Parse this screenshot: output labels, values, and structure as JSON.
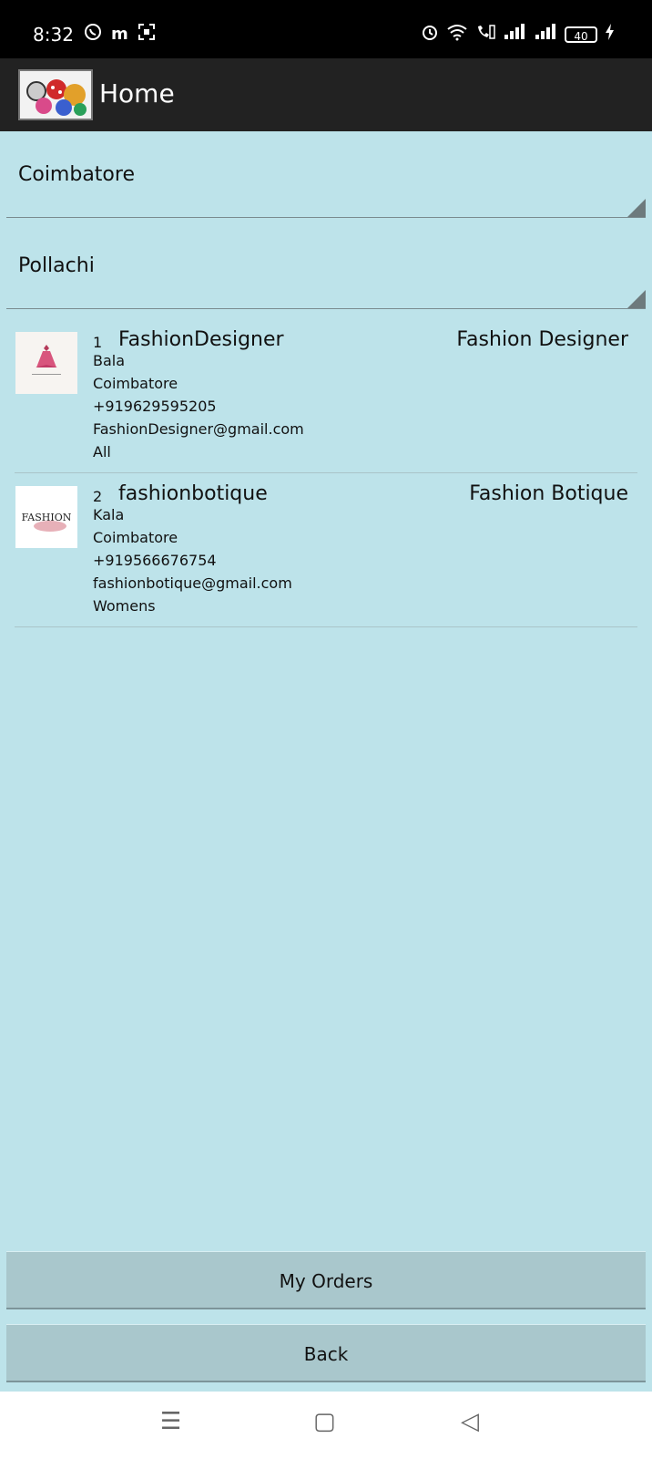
{
  "status_bar": {
    "time": "8:32",
    "left_icons": [
      "whatsapp-icon",
      "m-app-icon",
      "screenshot-icon"
    ],
    "right_icons": [
      "alarm-icon",
      "wifi-icon",
      "volte-call-icon",
      "signal-icon",
      "signal-icon"
    ],
    "battery": "40"
  },
  "app_bar": {
    "title": "Home"
  },
  "filters": {
    "district": "Coimbatore",
    "city": "Pollachi"
  },
  "shops": [
    {
      "num": "1",
      "username": "FashionDesigner",
      "category": "Fashion Designer",
      "owner": "Bala",
      "city": "Coimbatore",
      "phone": "+919629595205",
      "email": "FashionDesigner@gmail.com",
      "type": "All"
    },
    {
      "num": "2",
      "username": "fashionbotique",
      "category": "Fashion Botique",
      "owner": "Kala",
      "city": "Coimbatore",
      "phone": "+919566676754",
      "email": "fashionbotique@gmail.com",
      "type": "Womens",
      "logo_text": "FASHION"
    }
  ],
  "buttons": {
    "orders": "My Orders",
    "back": "Back"
  },
  "nav": {
    "menu": "☰",
    "home": "▢",
    "back": "◁"
  }
}
